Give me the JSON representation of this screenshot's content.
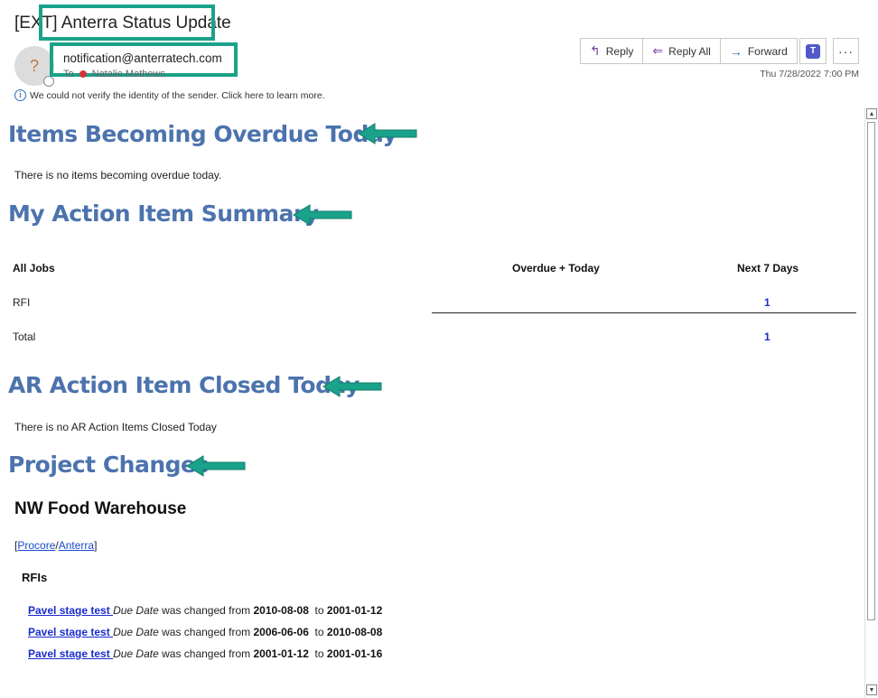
{
  "email": {
    "subject": "[EXT] Anterra Status Update",
    "sender": "notification@anterratech.com",
    "avatar_initial": "?",
    "to_label": "To",
    "recipient": "Natalie Mathews",
    "security_warning": "We could not verify the identity of the sender. Click here to learn more.",
    "timestamp": "Thu 7/28/2022 7:00 PM"
  },
  "toolbar": {
    "reply": "Reply",
    "reply_all": "Reply All",
    "forward": "Forward",
    "teams_label": "T",
    "more": "···"
  },
  "sections": {
    "overdue_title": "Items Becoming Overdue Today",
    "overdue_text": "There is no items becoming overdue today.",
    "summary_title": "My Action Item Summary",
    "ar_title": "AR Action Item Closed Today",
    "ar_text": "There is no AR Action Items Closed Today",
    "project_title": "Project Changes"
  },
  "summary_table": {
    "headers": [
      "All Jobs",
      "Overdue + Today",
      "Next 7 Days"
    ],
    "rows": [
      {
        "label": "RFI",
        "overdue": "",
        "next7": "1"
      },
      {
        "label": "Total",
        "overdue": "",
        "next7": "1"
      }
    ]
  },
  "project": {
    "name": "NW Food Warehouse",
    "link_open": "[",
    "link_procore": "Procore",
    "link_sep": "/",
    "link_anterra": "Anterra",
    "link_close": "]",
    "rfis_heading": "RFIs",
    "changes": [
      {
        "item": "Pavel stage test ",
        "field": "Due Date",
        "text": " was changed from ",
        "from": "2010-08-08",
        "to_word": "  to ",
        "to": "2001-01-12"
      },
      {
        "item": "Pavel stage test ",
        "field": "Due Date",
        "text": " was changed from ",
        "from": "2006-06-06",
        "to_word": "  to ",
        "to": "2010-08-08"
      },
      {
        "item": "Pavel stage test ",
        "field": "Due Date",
        "text": " was changed from ",
        "from": "2001-01-12",
        "to_word": "  to ",
        "to": "2001-01-16"
      }
    ]
  },
  "colors": {
    "heading": "#4c73ad",
    "highlight": "#1aa28a",
    "link": "#1a2ccc"
  }
}
